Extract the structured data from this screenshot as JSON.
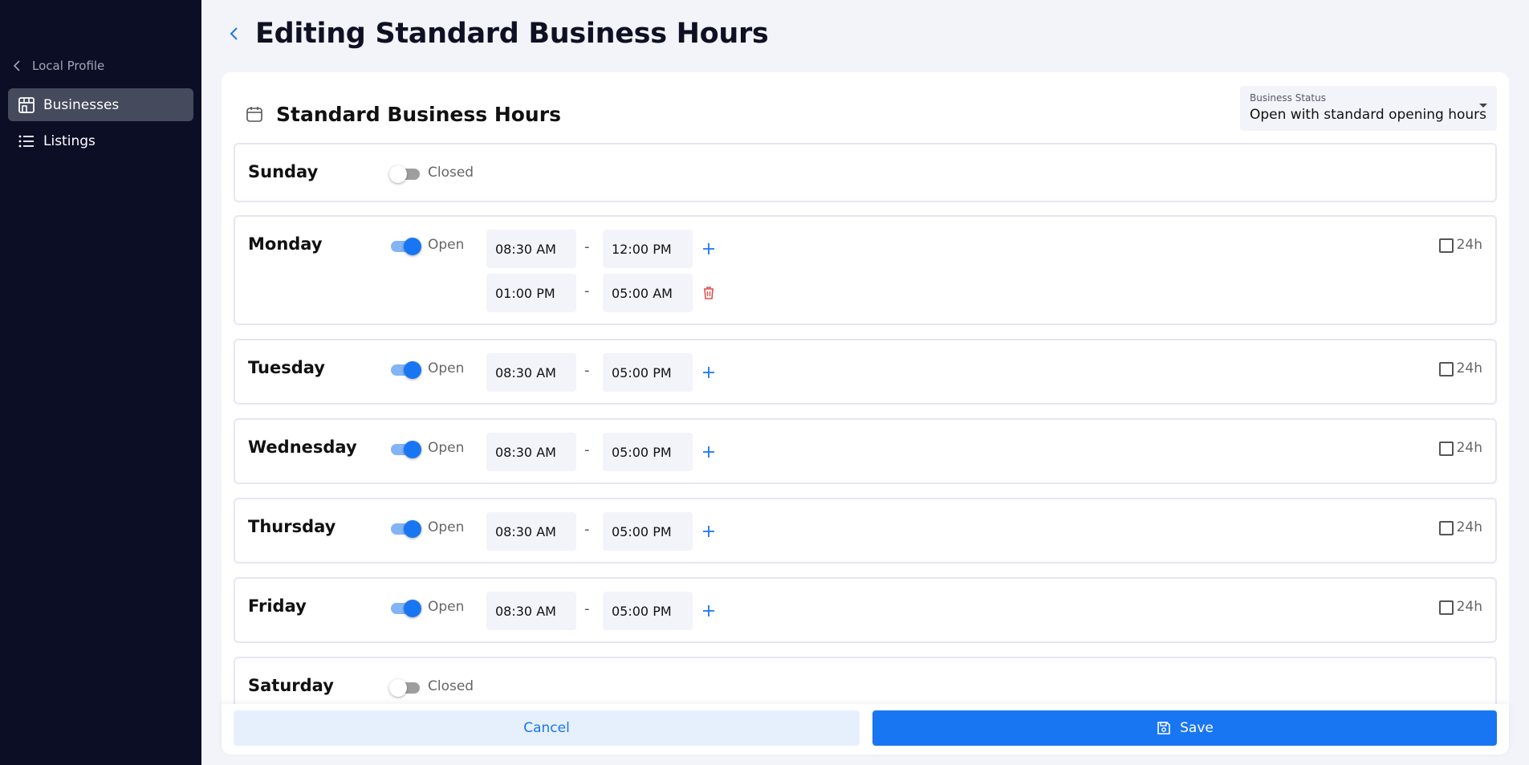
{
  "colors": {
    "sidebar_bg": "#0c0e26",
    "sidebar_active": "#454a5d",
    "primary": "#1976f2",
    "delete": "#e05050",
    "page_bg": "#f3f4f9"
  },
  "sidebar": {
    "back_label": "Local Profile",
    "back_icon": "chevron-left-icon",
    "items": [
      {
        "label": "Businesses",
        "icon": "storefront-icon",
        "active": true
      },
      {
        "label": "Listings",
        "icon": "list-icon",
        "active": false
      }
    ]
  },
  "header": {
    "title": "Editing Standard Business Hours",
    "back_icon": "chevron-left-icon"
  },
  "card": {
    "title": "Standard Business Hours",
    "icon": "calendar-icon",
    "status": {
      "label": "Business Status",
      "value": "Open with standard opening hours"
    }
  },
  "days": [
    {
      "name": "Sunday",
      "open": false,
      "status_label": "Closed"
    },
    {
      "name": "Monday",
      "open": true,
      "status_label": "Open",
      "all_day_label": "24h",
      "ranges": [
        {
          "start": "08:30 AM",
          "end": "12:00 PM"
        },
        {
          "start": "01:00 PM",
          "end": "05:00 AM"
        }
      ]
    },
    {
      "name": "Tuesday",
      "open": true,
      "status_label": "Open",
      "all_day_label": "24h",
      "ranges": [
        {
          "start": "08:30 AM",
          "end": "05:00 PM"
        }
      ]
    },
    {
      "name": "Wednesday",
      "open": true,
      "status_label": "Open",
      "all_day_label": "24h",
      "ranges": [
        {
          "start": "08:30 AM",
          "end": "05:00 PM"
        }
      ]
    },
    {
      "name": "Thursday",
      "open": true,
      "status_label": "Open",
      "all_day_label": "24h",
      "ranges": [
        {
          "start": "08:30 AM",
          "end": "05:00 PM"
        }
      ]
    },
    {
      "name": "Friday",
      "open": true,
      "status_label": "Open",
      "all_day_label": "24h",
      "ranges": [
        {
          "start": "08:30 AM",
          "end": "05:00 PM"
        }
      ]
    },
    {
      "name": "Saturday",
      "open": false,
      "status_label": "Closed"
    }
  ],
  "separator": "-",
  "footer": {
    "cancel_label": "Cancel",
    "save_label": "Save",
    "save_icon": "save-icon"
  }
}
